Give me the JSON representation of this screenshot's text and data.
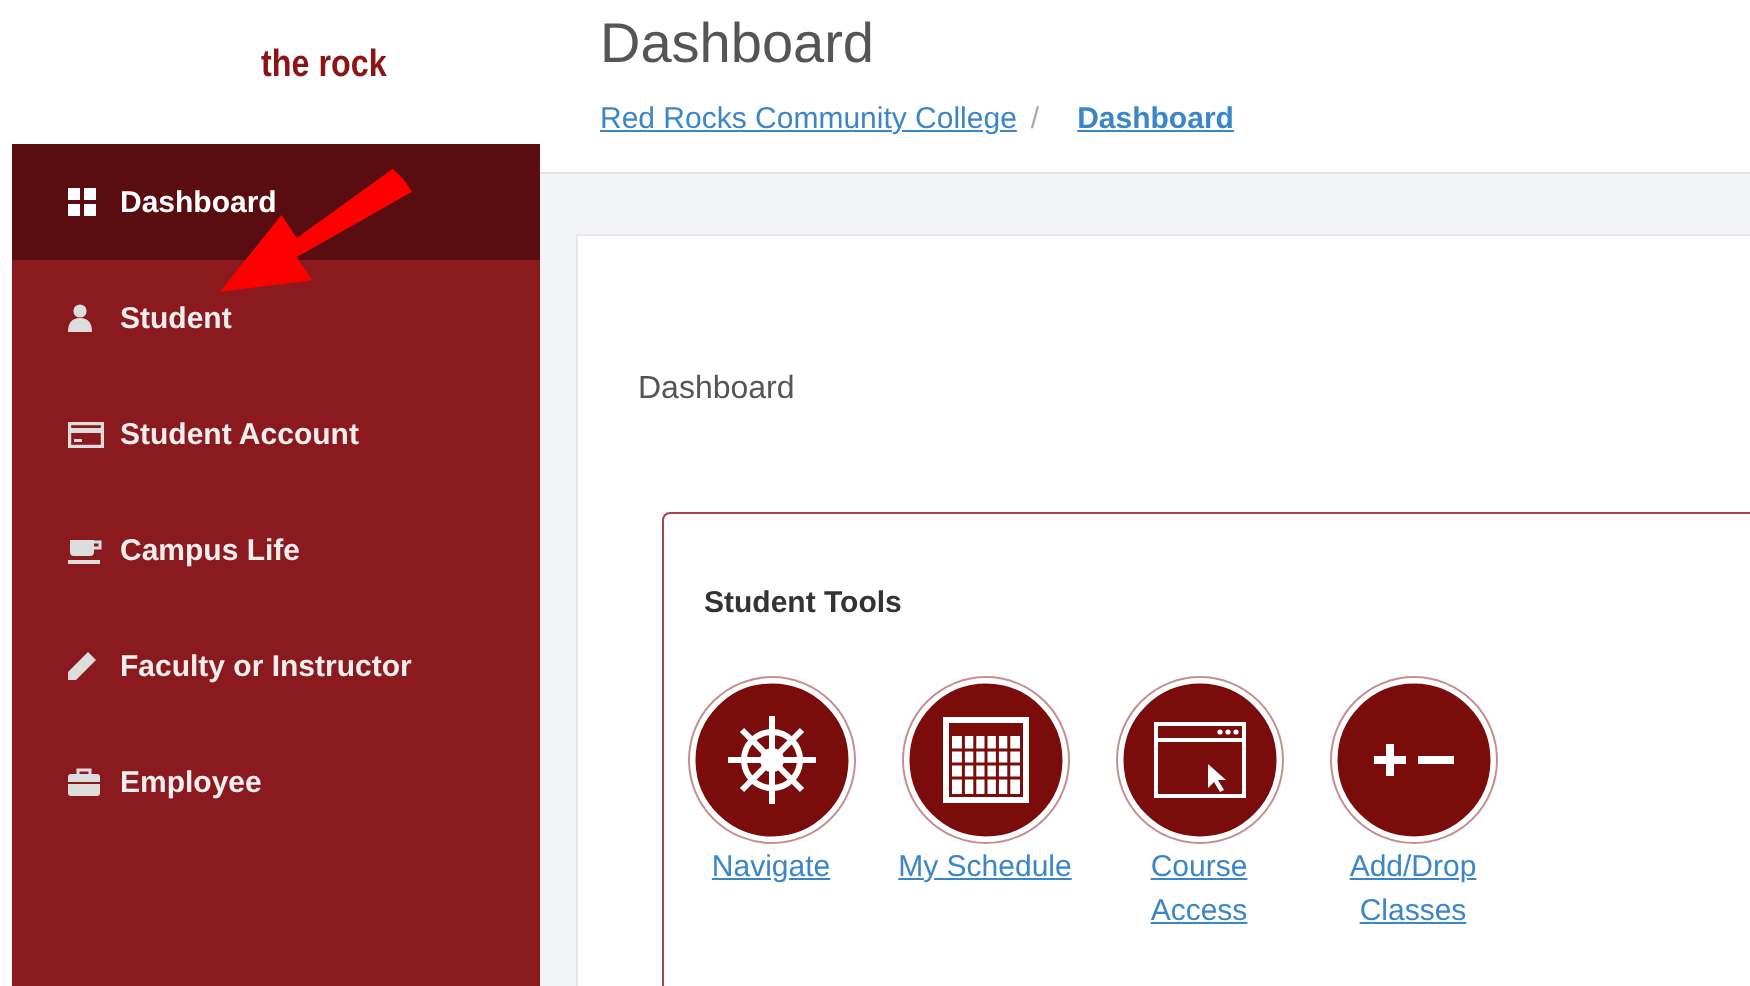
{
  "logo": "the rock",
  "sidebar": {
    "items": [
      {
        "label": "Dashboard",
        "selected": true
      },
      {
        "label": "Student",
        "selected": false
      },
      {
        "label": "Student Account",
        "selected": false
      },
      {
        "label": "Campus Life",
        "selected": false
      },
      {
        "label": "Faculty or Instructor",
        "selected": false
      },
      {
        "label": "Employee",
        "selected": false
      }
    ]
  },
  "page_title": "Dashboard",
  "breadcrumb": [
    {
      "label": "Red Rocks Community College",
      "current": false
    },
    {
      "label": "Dashboard",
      "current": true
    }
  ],
  "breadcrumb_separator": "/",
  "panel": {
    "heading": "Dashboard",
    "card": {
      "title": "Student Tools",
      "tools": [
        "Navigate",
        "My Schedule",
        "Course Access",
        "Add/Drop Classes"
      ]
    }
  }
}
